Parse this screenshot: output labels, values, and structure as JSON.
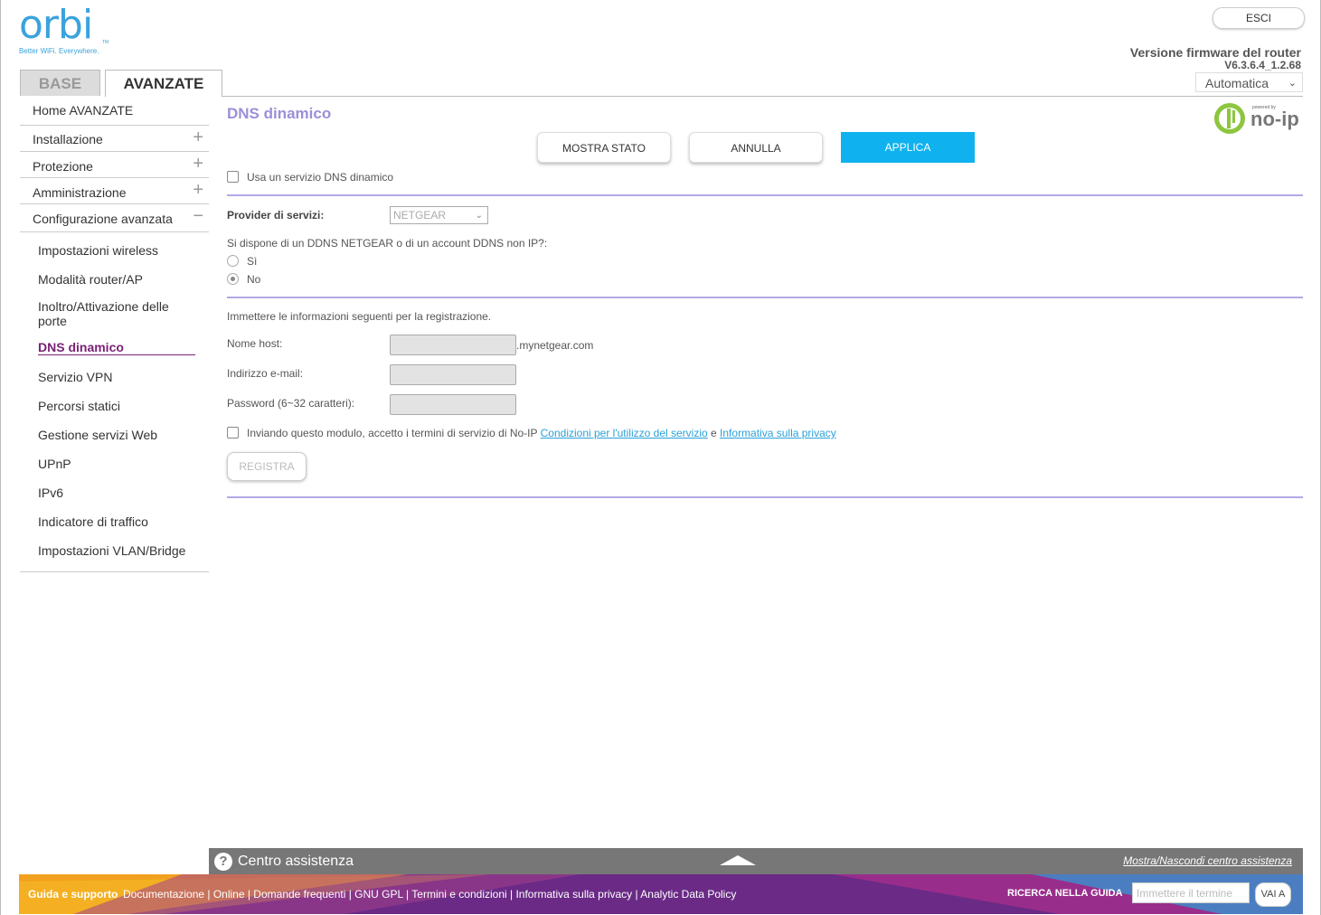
{
  "brand": {
    "logo": "orbi",
    "tagline": "Better WiFi. Everywhere.",
    "tm": "TM",
    "color": "#3aa3dc"
  },
  "tabs": {
    "base": "BASE",
    "advanced": "AVANZATE"
  },
  "header": {
    "logout": "ESCI",
    "firmware_label": "Versione firmware del router",
    "firmware_version": "V6.3.6.4_1.2.68",
    "refresh": "Automatica"
  },
  "sidebar": {
    "home": "Home AVANZATE",
    "setup": "Installazione",
    "security": "Protezione",
    "admin": "Amministrazione",
    "advanced_setup": "Configurazione avanzata",
    "plus": "+",
    "minus": "−",
    "items": [
      "Impostazioni wireless",
      "Modalità router/AP",
      "Inoltro/Attivazione delle porte",
      "DNS dinamico",
      "Servizio VPN",
      "Percorsi statici",
      "Gestione servizi Web",
      "UPnP",
      "IPv6",
      "Indicatore di traffico",
      "Impostazioni VLAN/Bridge"
    ]
  },
  "main": {
    "title": "DNS dinamico",
    "noip_powered": "powered by",
    "noip_brand": "no-ip",
    "buttons": {
      "status": "MOSTRA STATO",
      "cancel": "ANNULLA",
      "apply": "APPLICA"
    },
    "use_ddns": "Usa un servizio DNS dinamico",
    "provider_label": "Provider di servizi:",
    "provider_value": "NETGEAR",
    "question": "Si dispone di un DDNS NETGEAR o di un account DDNS non IP?:",
    "yes": "Sì",
    "no": "No",
    "reg_intro": "Immettere le informazioni seguenti per la registrazione.",
    "host_label": "Nome host:",
    "host_suffix": ".mynetgear.com",
    "email_label": "Indirizzo e-mail:",
    "password_label": "Password (6~32 caratteri):",
    "terms_text": "Inviando questo modulo, accetto i termini di servizio di No-IP",
    "terms_link": "Condizioni per l'utilizzo del servizio",
    "and": "e",
    "privacy_link": "Informativa sulla privacy",
    "register": "REGISTRA"
  },
  "help": {
    "q": "?",
    "title": "Centro assistenza",
    "toggle": "Mostra/Nascondi centro assistenza"
  },
  "footer": {
    "label": "Guida e supporto",
    "links": "Documentazione | Online | Domande frequenti | GNU GPL | Termini e condizioni | Informativa sulla privacy | Analytic Data Policy",
    "search_label": "RICERCA NELLA GUIDA",
    "search_placeholder": "Immettere il termine",
    "go": "VAI A"
  },
  "colors": {
    "accent": "#9b8fd8",
    "apply": "#0fb2ee",
    "active_nav": "#7a2177",
    "divider": "#b3a8e6"
  }
}
